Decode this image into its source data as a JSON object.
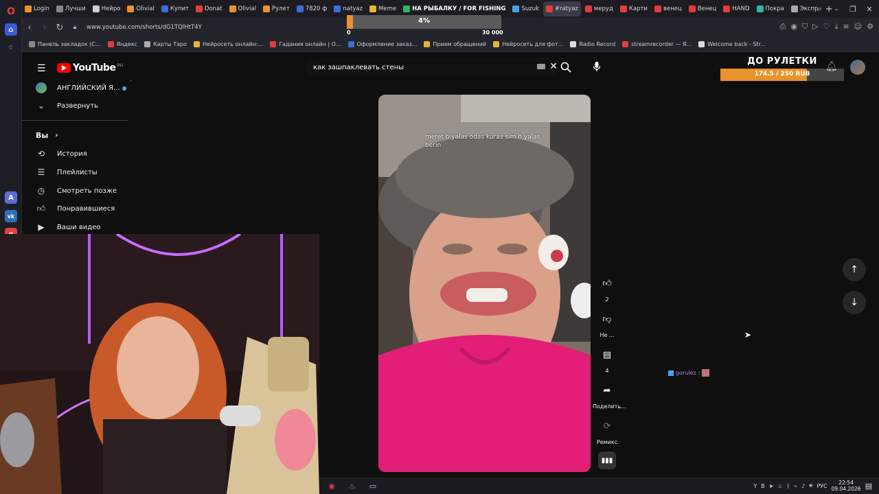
{
  "browser": {
    "tabs": [
      {
        "label": "Login",
        "color": "#e8932d"
      },
      {
        "label": "Лучши",
        "color": "#888888"
      },
      {
        "label": "Нейро",
        "color": "#d0d0d0"
      },
      {
        "label": "Olivial",
        "color": "#e8932d"
      },
      {
        "label": "Купит",
        "color": "#3b6fd6"
      },
      {
        "label": "Donat",
        "color": "#e33d3d"
      },
      {
        "label": "Olivial",
        "color": "#e8932d"
      },
      {
        "label": "Рулет",
        "color": "#e8932d"
      },
      {
        "label": "7820 ф",
        "color": "#3b6fd6"
      },
      {
        "label": "natyaz",
        "color": "#3b6fd6"
      },
      {
        "label": "Meme",
        "color": "#e8b52d"
      },
      {
        "label": "НА РЫБАЛКУ / FOR FISHING",
        "color": "#2eb85c"
      },
      {
        "label": "Suzuk",
        "color": "#4aa3df"
      },
      {
        "label": "#ratyaz",
        "color": "#e33d3d"
      },
      {
        "label": "меруд",
        "color": "#e33d3d"
      },
      {
        "label": "Карти",
        "color": "#e33d3d"
      },
      {
        "label": "венец",
        "color": "#e33d3d"
      },
      {
        "label": "Венец",
        "color": "#e33d3d"
      },
      {
        "label": "HAND",
        "color": "#e33d3d"
      },
      {
        "label": "Покра",
        "color": "#2eb8a0"
      },
      {
        "label": "Экспр",
        "color": "#aaaaaa"
      }
    ],
    "url": "www.youtube.com/shorts/dG1TQlHtT4Y",
    "bookmarks": [
      {
        "label": "Панель закладок (С...",
        "color": "#888888"
      },
      {
        "label": "Яндекс",
        "color": "#e33d3d"
      },
      {
        "label": "Карты Таро",
        "color": "#aaaaaa"
      },
      {
        "label": "Нейросеть онлайн:...",
        "color": "#e8b52d"
      },
      {
        "label": "Гадания онлайн | О...",
        "color": "#e33d3d"
      },
      {
        "label": "Оформление заказ...",
        "color": "#3b6fd6"
      },
      {
        "label": "Прием обращений",
        "color": "#e8b52d"
      },
      {
        "label": "Нейросеть для фот...",
        "color": "#e8b52d"
      },
      {
        "label": "Radio Record",
        "color": "#dddddd"
      },
      {
        "label": "streamrecorder — Я...",
        "color": "#e33d3d"
      },
      {
        "label": "Welcome back - Str...",
        "color": "#dddddd"
      }
    ]
  },
  "donation_goal": {
    "percent_label": "4%",
    "progress": 0.04,
    "min_label": "0",
    "max_label": "30 000"
  },
  "youtube": {
    "logo": "YouTube",
    "region": "RU",
    "search_query": "как зашпаклевать стены",
    "sidebar": {
      "channel": "АНГЛИЙСКИЙ Я...",
      "expand": "Развернуть",
      "you": "Вы",
      "items": [
        {
          "label": "История",
          "icon": "history-icon"
        },
        {
          "label": "Плейлисты",
          "icon": "playlist-icon"
        },
        {
          "label": "Смотреть позже",
          "icon": "clock-icon"
        },
        {
          "label": "Понравившиеся",
          "icon": "like-icon"
        },
        {
          "label": "Ваши видео",
          "icon": "video-icon"
        }
      ]
    },
    "short": {
      "caption": "meret b yalas odas kuras sim h yalas berin",
      "likes": "2",
      "dislike_label": "Не ...",
      "comments": "4",
      "share_label": "Поделить...",
      "remix_label": "Ремикс"
    }
  },
  "roulette": {
    "title": "ДО РУЛЕТКИ",
    "amount": "174.5 / 250 RUB",
    "progress": 0.698
  },
  "chat": {
    "user": "gorulez",
    "separator": ":"
  },
  "taskbar": {
    "lang": "РУС",
    "time": "22:54",
    "date": "09.04.2026"
  }
}
